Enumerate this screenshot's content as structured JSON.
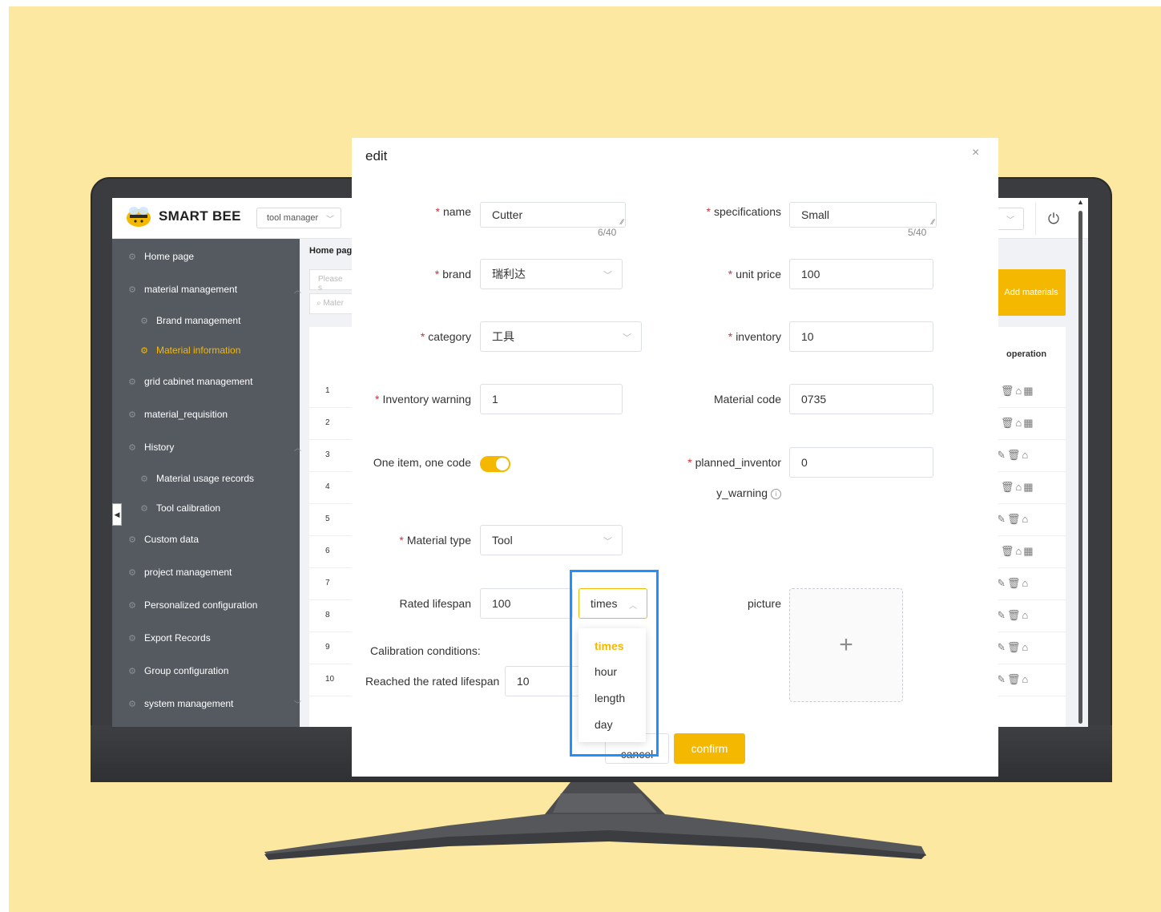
{
  "app": {
    "brand": "SMART BEE",
    "role_select": "tool manager",
    "breadcrumb": "Home pag",
    "search_placeholder_1": "Please s",
    "search_placeholder_2": "Mater",
    "add_button": "Add materials",
    "operation_header": "operation"
  },
  "sidebar": {
    "items": [
      {
        "label": "Home page"
      },
      {
        "label": "material management"
      },
      {
        "label": "Brand management"
      },
      {
        "label": "Material information",
        "active": true
      },
      {
        "label": "grid cabinet management"
      },
      {
        "label": "material_requisition"
      },
      {
        "label": "History"
      },
      {
        "label": "Material usage records"
      },
      {
        "label": "Tool calibration"
      },
      {
        "label": "Custom data"
      },
      {
        "label": "project management"
      },
      {
        "label": "Personalized configuration"
      },
      {
        "label": "Export Records"
      },
      {
        "label": "Group configuration"
      },
      {
        "label": "system management"
      }
    ]
  },
  "table": {
    "rows": [
      "1",
      "2",
      "3",
      "4",
      "5",
      "6",
      "7",
      "8",
      "9",
      "10"
    ],
    "ops_full": "✎🗑⌂▦",
    "ops_short": "✎🗑⌂"
  },
  "modal": {
    "title": "edit",
    "close": "×",
    "fields": {
      "name": {
        "label": "name",
        "value": "Cutter",
        "counter": "6/40"
      },
      "specifications": {
        "label": "specifications",
        "value": "Small",
        "counter": "5/40"
      },
      "brand": {
        "label": "brand",
        "value": "瑞利达"
      },
      "unit_price": {
        "label": "unit price",
        "value": "100"
      },
      "category": {
        "label": "category",
        "value": "工具"
      },
      "inventory": {
        "label": "inventory",
        "value": "10"
      },
      "inventory_warning": {
        "label": "Inventory warning",
        "value": "1"
      },
      "material_code": {
        "label": "Material code",
        "value": "0735"
      },
      "one_item_one_code": {
        "label": "One item, one code",
        "enabled": true
      },
      "planned_inventory_warning": {
        "label_line1": "planned_inventor",
        "label_line2": "y_warning",
        "value": "0"
      },
      "material_type": {
        "label": "Material type",
        "value": "Tool"
      },
      "rated_lifespan": {
        "label": "Rated lifespan",
        "value": "100",
        "unit": "times"
      },
      "picture": {
        "label": "picture",
        "upload_icon": "+"
      },
      "calibration_conditions": {
        "label": "Calibration conditions:"
      },
      "reached_rated_lifespan": {
        "label": "Reached the rated lifespan",
        "value": "10"
      }
    },
    "unit_options": [
      "times",
      "hour",
      "length",
      "day"
    ],
    "selected_unit": "times",
    "cancel": "cancel",
    "confirm": "confirm"
  },
  "colors": {
    "background": "#fde8a2",
    "accent": "#f5b800",
    "sidebar": "#555a61",
    "highlight": "#1e90ff",
    "required": "#f5222d"
  }
}
